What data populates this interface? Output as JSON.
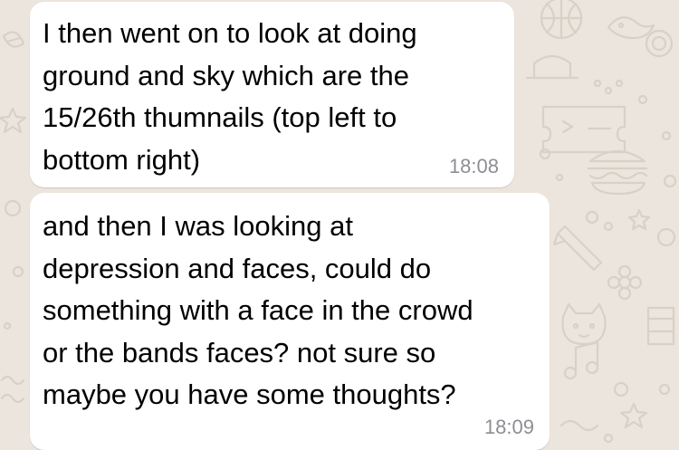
{
  "theme": {
    "chat_background": "#ece5dd",
    "bubble_color": "#ffffff",
    "text_color": "#000000",
    "timestamp_color": "#8e8e93",
    "doodle_color": "#d9d0c6"
  },
  "messages": [
    {
      "text": "I then went on to look at doing\nground and sky which are the\n15/26th thumnails (top left to\nbottom right)",
      "time": "18:08"
    },
    {
      "text": "and then I was looking at\ndepression and faces, could do\nsomething with a face in the crowd\nor the bands faces? not sure so\nmaybe you have some thoughts?",
      "time": "18:09"
    }
  ]
}
